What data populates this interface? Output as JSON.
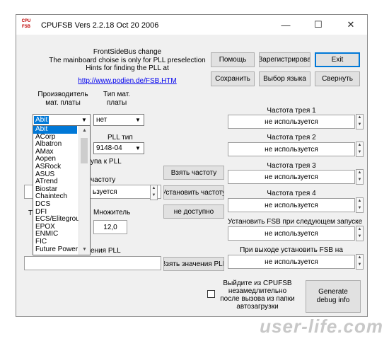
{
  "window": {
    "title": "CPUFSB  Vers 2.2.18  Oct 20 2006",
    "icon_label_top": "CPU",
    "icon_label_bottom": "FSB",
    "minimize_glyph": "—",
    "maximize_glyph": "☐",
    "close_glyph": "✕"
  },
  "info": {
    "line1": "FrontSideBus change",
    "line2": "The mainboard choise is only for PLL preselection",
    "line3": "Hints for finding the PLL at",
    "link": "http://www.podien.de/FSB.HTM"
  },
  "buttons": {
    "help": "Помощь",
    "register": "Зарегистрирова",
    "exit": "Exit",
    "save": "Сохранить",
    "language": "Выбор языка",
    "minimize": "Свернуть",
    "get_freq": "Взять частоту",
    "set_freq": "Установить частоту",
    "not_available": "не доступно",
    "get_pll": "Взять значения PLL",
    "debug": "Generate debug info"
  },
  "labels": {
    "manufacturer": "Производитель мат. платы",
    "board_type": "Тип мат. платы",
    "pll_type": "PLL тип",
    "access_pll": "упа к PLL",
    "freq_partial": "частоту",
    "multiplier": "Множитель",
    "pll_values_partial": "ения PLL",
    "t_partial": "Т"
  },
  "fields": {
    "board_type_value": "нет",
    "pll_type_value": "9148-04",
    "current_freq_partial": "ьзуется",
    "multiplier_value": "12,0"
  },
  "manufacturer_combo": {
    "selected": "Abit",
    "options": [
      "Abit",
      "ACorp",
      "Albatron",
      "AMax",
      "Aopen",
      "ASRock",
      "ASUS",
      "ATrend",
      "Biostar",
      "Chaintech",
      "DCS",
      "DFI",
      "ECS/Elitegroup",
      "EPOX",
      "ENMIC",
      "FIC",
      "Future Power"
    ]
  },
  "tray": {
    "rows": [
      {
        "label": "Частота трея 1",
        "value": "не используется"
      },
      {
        "label": "Частота трея 2",
        "value": "не используется"
      },
      {
        "label": "Частота трея 3",
        "value": "не используется"
      },
      {
        "label": "Частота трея 4",
        "value": "не используется"
      },
      {
        "label": "Установить FSB при следующем запуске",
        "value": "не используется"
      },
      {
        "label": "При выходе установить FSB на",
        "value": "не используется"
      }
    ]
  },
  "checkbox": {
    "label": "Выйдите из CPUFSB незамедлительно после вызова из папки автозагрузки",
    "checked": false
  },
  "watermark": "user-life.com"
}
